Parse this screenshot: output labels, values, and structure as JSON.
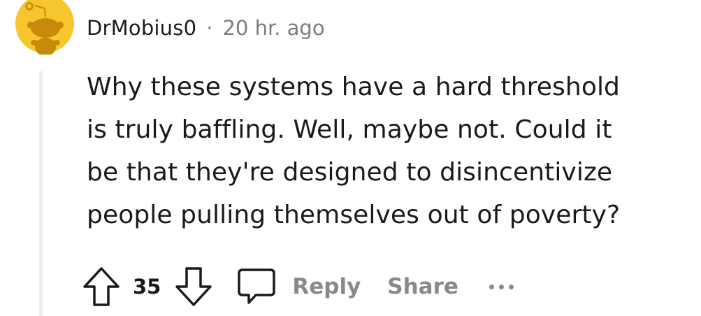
{
  "comment": {
    "username": "DrMobius0",
    "separator": "·",
    "timestamp": "20 hr. ago",
    "body_lines": [
      "Why these systems have a hard threshold",
      "is truly baffling. Well, maybe not. Could it",
      "be that they're designed to disincentivize",
      "people pulling themselves out of poverty?"
    ],
    "vote_count": "35",
    "reply_label": "Reply",
    "share_label": "Share"
  },
  "icons": {
    "avatar": "snoo-avatar-icon",
    "upvote": "upvote-arrow-icon",
    "downvote": "downvote-arrow-icon",
    "comment": "comment-bubble-icon",
    "more": "more-options-icon"
  },
  "colors": {
    "avatar_background": "#f7c52e",
    "meta_gray": "#7c7c7c",
    "action_gray": "#878a8c",
    "thread_line": "#ededed"
  }
}
